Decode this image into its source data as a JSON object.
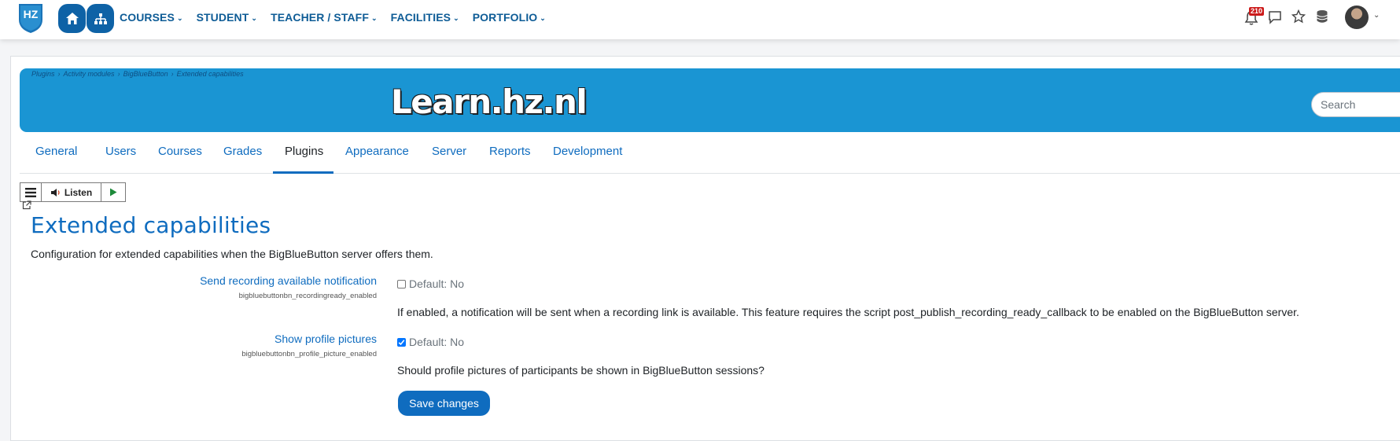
{
  "navbar": {
    "menu": [
      {
        "label": "COURSES"
      },
      {
        "label": "STUDENT"
      },
      {
        "label": "TEACHER / STAFF"
      },
      {
        "label": "FACILITIES"
      },
      {
        "label": "PORTFOLIO"
      }
    ],
    "notification_count": "210",
    "logo_text": "HZ"
  },
  "breadcrumb": [
    "Plugins",
    "Activity modules",
    "BigBlueButton",
    "Extended capabilities"
  ],
  "site_title": "Learn.hz.nl",
  "search_placeholder": "Search",
  "tabs": [
    "General",
    "Users",
    "Courses",
    "Grades",
    "Plugins",
    "Appearance",
    "Server",
    "Reports",
    "Development"
  ],
  "active_tab": "Plugins",
  "listen_toolbar": {
    "listen_label": "Listen"
  },
  "heading": "Extended capabilities",
  "description": "Configuration for extended capabilities when the BigBlueButton server offers them.",
  "settings": [
    {
      "label": "Send recording available notification",
      "key": "bigbluebuttonbn_recordingready_enabled",
      "checked": false,
      "default_text": "Default: No",
      "help": "If enabled, a notification will be sent when a recording link is available. This feature requires the script post_publish_recording_ready_callback to be enabled on the BigBlueButton server."
    },
    {
      "label": "Show profile pictures",
      "key": "bigbluebuttonbn_profile_picture_enabled",
      "checked": true,
      "default_text": "Default: No",
      "help": "Should profile pictures of participants be shown in BigBlueButton sessions?"
    }
  ],
  "save_label": "Save changes",
  "colors": {
    "brand_blue": "#1a95d3",
    "link_blue": "#0f6cbf",
    "nav_blue": "#0e62a6",
    "badge_red": "#cc1b1b"
  }
}
